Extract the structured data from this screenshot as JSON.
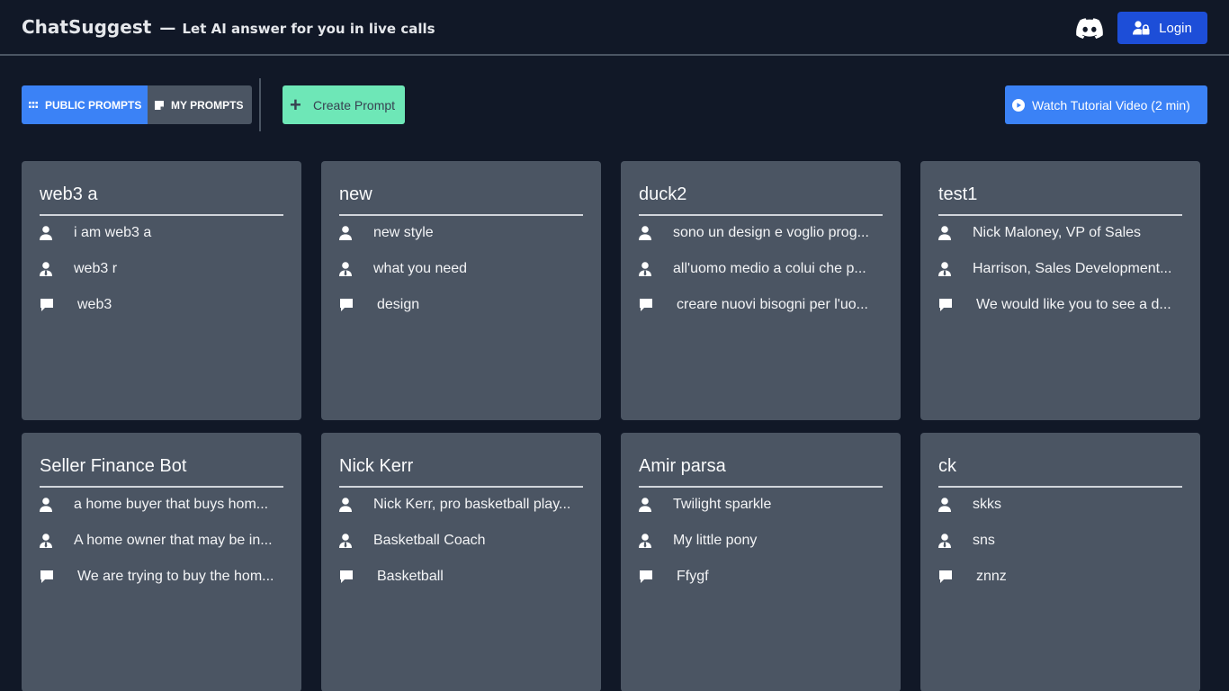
{
  "header": {
    "brand": "ChatSuggest",
    "dash": "—",
    "tagline": "Let AI answer for you in live calls",
    "login_label": "Login"
  },
  "toolbar": {
    "tabs": [
      {
        "label": "PUBLIC PROMPTS",
        "active": true
      },
      {
        "label": "MY PROMPTS",
        "active": false
      }
    ],
    "create_label": "Create Prompt",
    "tutorial_label": "Watch Tutorial Video (2 min)"
  },
  "colors": {
    "background": "#111827",
    "card": "#4b5563",
    "primary": "#3b82f6",
    "login": "#1d4ed8",
    "create": "#6ee7b7"
  },
  "icons": {
    "discord": "discord-icon",
    "login": "user-lock-icon",
    "public_tab": "grid-icon",
    "my_tab": "note-icon",
    "create": "plus-icon",
    "tutorial": "play-circle-icon",
    "you": "user-icon",
    "other": "user-tie-icon",
    "topic": "comment-icon"
  },
  "cards": [
    {
      "title": "web3 a",
      "you": "i am web3 a",
      "other": "web3 r",
      "topic": "web3"
    },
    {
      "title": "new",
      "you": "new style",
      "other": "what you need",
      "topic": "design"
    },
    {
      "title": "duck2",
      "you": "sono un design e voglio prog...",
      "other": "all'uomo medio a colui che p...",
      "topic": "creare nuovi bisogni per l'uo..."
    },
    {
      "title": "test1",
      "you": "Nick Maloney, VP of Sales",
      "other": "Harrison, Sales Development...",
      "topic": "We would like you to see a d..."
    },
    {
      "title": "Seller Finance Bot",
      "you": "a home buyer that buys hom...",
      "other": "A home owner that may be in...",
      "topic": "We are trying to buy the hom..."
    },
    {
      "title": "Nick Kerr",
      "you": "Nick Kerr, pro basketball play...",
      "other": "Basketball Coach",
      "topic": "Basketball"
    },
    {
      "title": "Amir parsa",
      "you": "Twilight sparkle",
      "other": "My little pony",
      "topic": "Ffygf"
    },
    {
      "title": "ck",
      "you": "skks",
      "other": "sns",
      "topic": "znnz"
    }
  ]
}
